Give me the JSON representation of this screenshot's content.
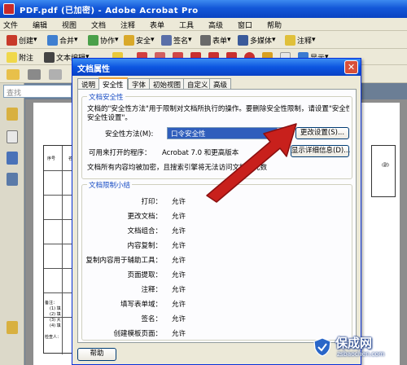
{
  "app": {
    "window_title": "PDF.pdf (已加密) - Adobe Acrobat Pro",
    "menus": [
      "文件",
      "编辑",
      "视图",
      "文档",
      "注释",
      "表单",
      "工具",
      "高级",
      "窗口",
      "帮助"
    ],
    "toolbar1": [
      "创建",
      "合并",
      "协作",
      "安全",
      "签名",
      "表单",
      "多媒体",
      "注释"
    ],
    "toolbar2": [
      "附注",
      "文本编辑",
      "显示"
    ],
    "search_placeholder": "查找"
  },
  "dialog": {
    "title": "文档属性",
    "tabs": [
      "说明",
      "安全性",
      "字体",
      "初始视图",
      "自定义",
      "高级"
    ],
    "active_tab": "安全性",
    "security_group_label": "文档安全性",
    "security_desc_1": "文档的\"安全性方法\"用于限制对文档所执行的操作。要删除安全性限制，请设置\"安全性方法\"为\"无",
    "security_desc_2": "安全性设置\"。",
    "method_label": "安全性方法(M):",
    "method_value": "口令安全性",
    "change_settings_button": "更改设置(S)...",
    "compat_label": "可用来打开的程序：",
    "compat_value": "Acrobat 7.0 和更高版本",
    "details_button": "显示详细信息(D)...",
    "encrypt_note": "文档所有内容均被加密，且搜索引擎将无法访问文档的元数",
    "restrictions_group_label": "文档限制小结",
    "permissions": [
      {
        "label": "打印：",
        "value": "允许"
      },
      {
        "label": "更改文档：",
        "value": "允许"
      },
      {
        "label": "文档组合：",
        "value": "允许"
      },
      {
        "label": "内容复制：",
        "value": "允许"
      },
      {
        "label": "复制内容用于辅助工具：",
        "value": "允许"
      },
      {
        "label": "页面提取：",
        "value": "允许"
      },
      {
        "label": "注释：",
        "value": "允许"
      },
      {
        "label": "填写表单域：",
        "value": "允许"
      },
      {
        "label": "签名：",
        "value": "允许"
      },
      {
        "label": "创建模板页面：",
        "value": "允许"
      }
    ],
    "help_button": "帮助"
  },
  "page": {
    "col_headers": [
      "序号",
      "名称"
    ],
    "right_header": "(副)",
    "notes": [
      "备注：",
      "(1) 填",
      "(2) 填",
      "(3) 大",
      "(4) 填"
    ],
    "signature_label": "检查人："
  },
  "watermark": {
    "brand": "保成网",
    "url": "zsbaochen.com"
  },
  "colors": {
    "titlebar_blue": "#0c55e0",
    "arrow_red": "#c8201c",
    "tab_highlight": "#f1a43a",
    "group_label_blue": "#1a4ec4"
  }
}
